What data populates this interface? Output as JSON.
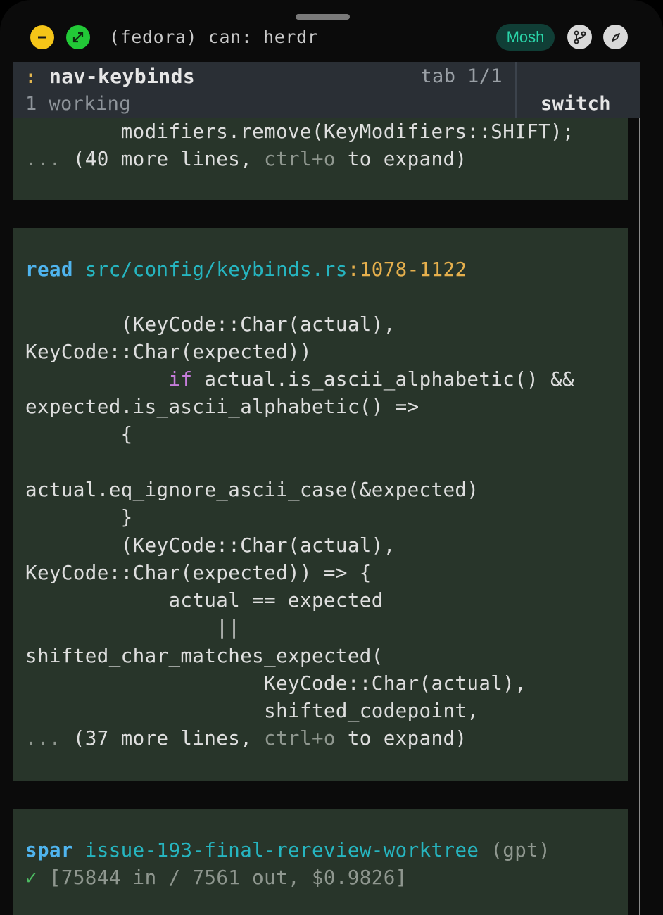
{
  "window": {
    "title": "(fedora) can: herdr",
    "connection_badge": "Mosh",
    "minimize_icon": "minus-icon",
    "maximize_icon": "expand-arrows-icon",
    "branch_icon": "git-branch-icon",
    "compass_icon": "compass-icon"
  },
  "tabbar": {
    "icon": ":",
    "name": "nav-keybinds",
    "counter": "tab 1/1",
    "status": "1 working",
    "switch_label": "switch"
  },
  "block1": {
    "line1": "        modifiers.remove(KeyModifiers::SHIFT);",
    "more_prefix": "... ",
    "more_count": "(40 more lines, ",
    "more_hint": "ctrl+o",
    "more_suffix": " to expand)"
  },
  "block2": {
    "command": "read",
    "path": "src/config/keybinds.rs",
    "colon": ":",
    "range": "1078-1122",
    "lines": [
      "        (KeyCode::Char(actual),",
      "KeyCode::Char(expected))",
      "            ",
      "if",
      " actual.is_ascii_alphabetic() &&",
      "expected.is_ascii_alphabetic() =>",
      "        {",
      "actual.eq_ignore_ascii_case(&expected)",
      "        }",
      "        (KeyCode::Char(actual),",
      "KeyCode::Char(expected)) => {",
      "            actual == expected",
      "                ||",
      "shifted_char_matches_expected(",
      "                    KeyCode::Char(actual),",
      "                    shifted_codepoint,"
    ],
    "more_prefix": "... ",
    "more_count": "(37 more lines, ",
    "more_hint": "ctrl+o",
    "more_suffix": " to expand)"
  },
  "block3": {
    "command": "spar",
    "worktree": "issue-193-final-rereview-worktree",
    "model": " (gpt)",
    "check": "✓",
    "stats": " [75844 in / 7561 out, $0.9826]"
  },
  "colors": {
    "block_bg": "#28352a",
    "keyword": "#4fb4ee",
    "path": "#26b5c0",
    "range": "#e6b04d",
    "purple": "#c77ddc",
    "mosh_bg": "#103e36",
    "mosh_fg": "#2ad4a8"
  }
}
